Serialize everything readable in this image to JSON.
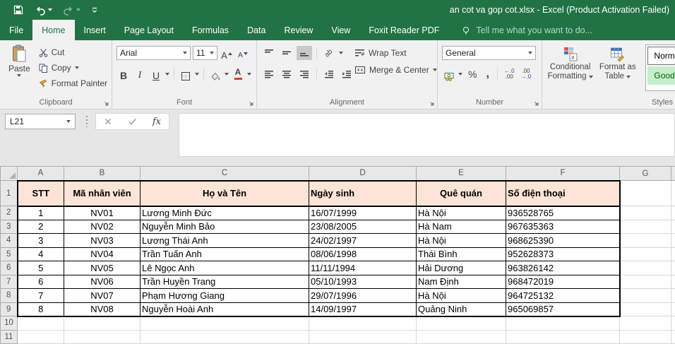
{
  "title_bar": {
    "title": "an cot va gop cot.xlsx - Excel (Product Activation Failed)"
  },
  "tabs": {
    "items": [
      "File",
      "Home",
      "Insert",
      "Page Layout",
      "Formulas",
      "Data",
      "Review",
      "View",
      "Foxit Reader PDF"
    ],
    "tell_me": "Tell me what you want to do..."
  },
  "ribbon": {
    "clipboard": {
      "label": "Clipboard",
      "paste": "Paste",
      "cut": "Cut",
      "copy": "Copy",
      "format_painter": "Format Painter"
    },
    "font": {
      "label": "Font",
      "font_name": "Arial",
      "font_size": "11",
      "bold": "B",
      "italic": "I",
      "underline": "U"
    },
    "alignment": {
      "label": "Alignment",
      "orientation_glyph": "ab",
      "wrap_text": "Wrap Text",
      "merge_center": "Merge & Center"
    },
    "number": {
      "label": "Number",
      "format": "General",
      "percent": "%",
      "comma": ",",
      "inc_dec_top": "←.0",
      "inc_dec_bottom": ".00",
      "dec_dec_top": ".00",
      "dec_dec_bottom": "→.0"
    },
    "styles": {
      "label": "Styles",
      "conditional_line1": "Conditional",
      "conditional_line2": "Formatting",
      "format_table_line1": "Format as",
      "format_table_line2": "Table",
      "style_normal": "Normal",
      "style_good": "Good"
    }
  },
  "formula_bar": {
    "name_box": "L21",
    "fx": "fx",
    "formula": ""
  },
  "sheet": {
    "column_letters": [
      "A",
      "B",
      "C",
      "D",
      "E",
      "F",
      "G"
    ],
    "row_numbers": [
      "1",
      "2",
      "3",
      "4",
      "5",
      "6",
      "7",
      "8",
      "9",
      "10",
      "11"
    ],
    "headers": [
      "STT",
      "Mã nhân viên",
      "Họ và Tên",
      "Ngày sinh",
      "Quê quán",
      "Số điện thoại"
    ],
    "rows": [
      [
        "1",
        "NV01",
        "Lương Minh Đức",
        "16/07/1999",
        "Hà Nội",
        "936528765"
      ],
      [
        "2",
        "NV02",
        "Nguyễn Minh Bảo",
        "23/08/2005",
        "Hà Nam",
        "967635363"
      ],
      [
        "3",
        "NV03",
        "Lương Thái Anh",
        "24/02/1997",
        "Hà Nội",
        "968625390"
      ],
      [
        "4",
        "NV04",
        "Trần Tuấn Anh",
        "08/06/1998",
        "Thái Bình",
        "952628373"
      ],
      [
        "5",
        "NV05",
        "Lê Ngọc Anh",
        "11/11/1994",
        "Hải Dương",
        "963826142"
      ],
      [
        "6",
        "NV06",
        "Trần Huyền Trang",
        "05/10/1993",
        "Nam Định",
        "968472019"
      ],
      [
        "7",
        "NV07",
        "Phạm Hương Giang",
        "29/07/1996",
        "Hà Nội",
        "964725132"
      ],
      [
        "8",
        "NV08",
        "Nguyễn Hoài Anh",
        "14/09/1997",
        "Quảng Ninh",
        "965069857"
      ]
    ]
  },
  "colors": {
    "excel_green": "#217346",
    "table_header_fill": "#fce4d6",
    "good_style_bg": "#c6efce",
    "good_style_text": "#006100",
    "font_color_red": "#e03c31",
    "gridline": "#d8d8d8",
    "table_border": "#000000"
  }
}
